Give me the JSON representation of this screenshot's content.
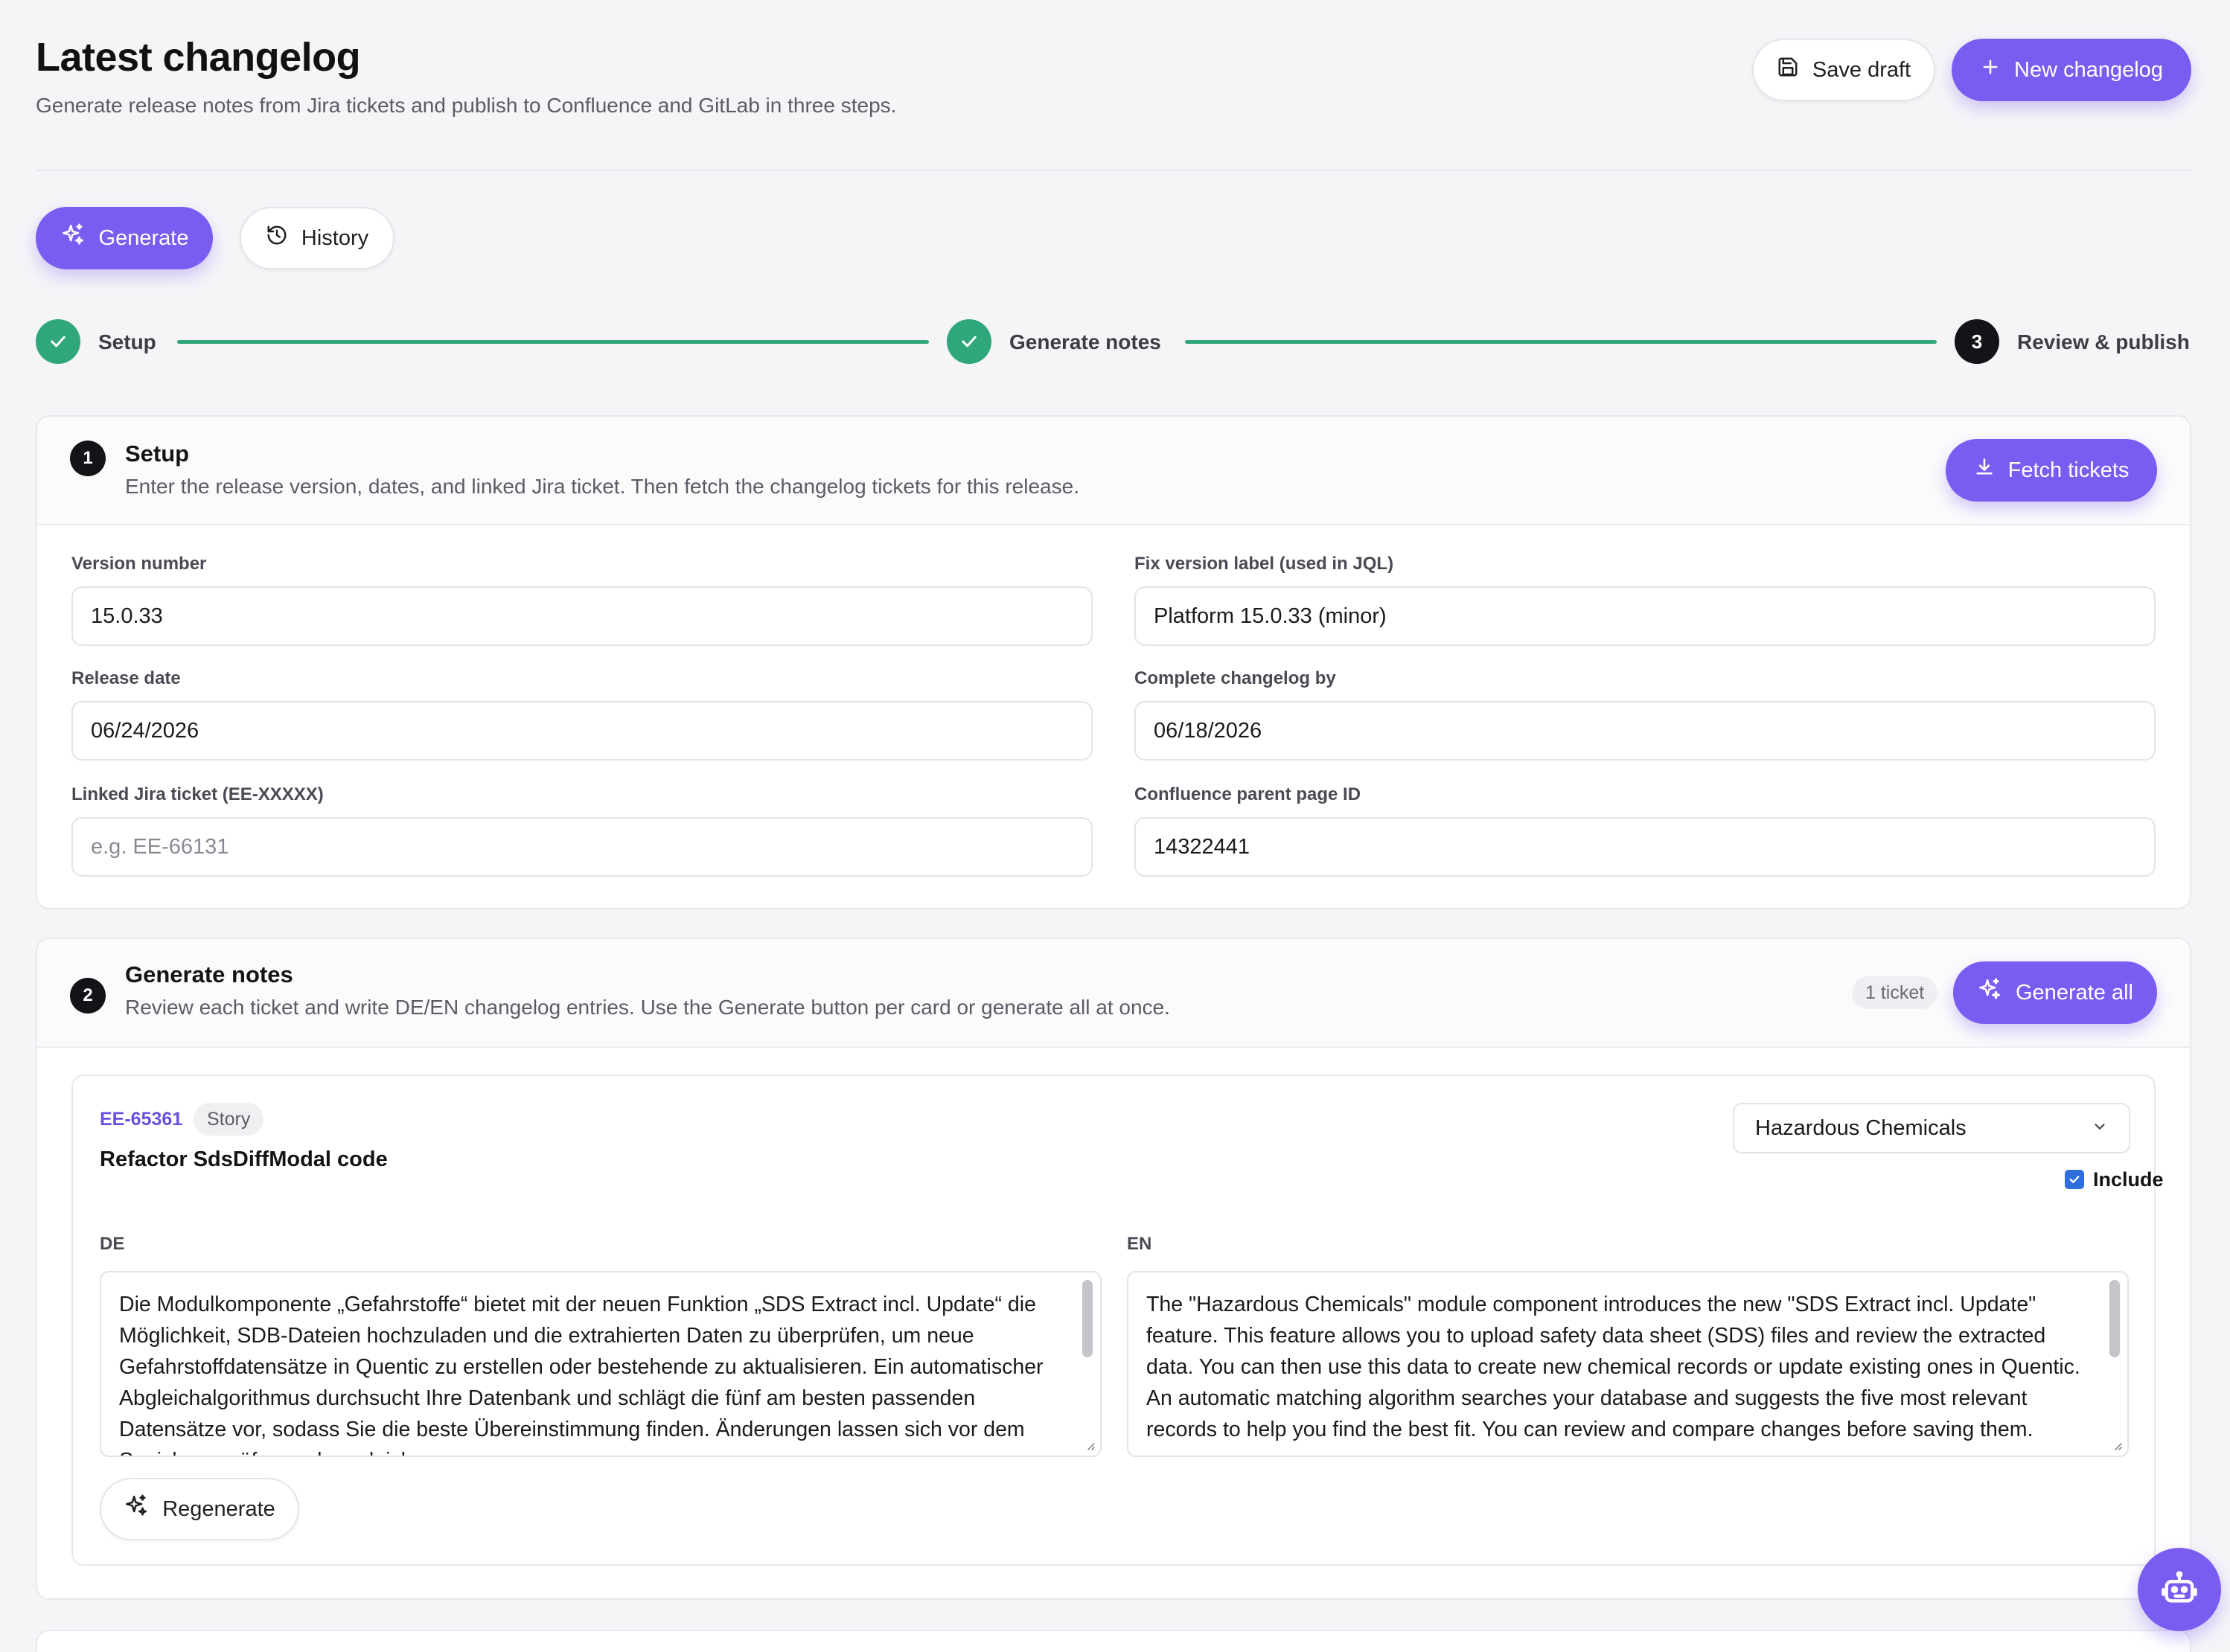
{
  "header": {
    "title": "Latest changelog",
    "subtitle": "Generate release notes from Jira tickets and publish to Confluence and GitLab in three steps.",
    "save_draft_label": "Save draft",
    "new_changelog_label": "New changelog"
  },
  "tabs": {
    "generate_label": "Generate",
    "history_label": "History"
  },
  "stepper": {
    "steps": [
      {
        "label": "Setup",
        "status": "done"
      },
      {
        "label": "Generate notes",
        "status": "done"
      },
      {
        "label": "Review & publish",
        "status": "current",
        "number": "3"
      }
    ]
  },
  "setup": {
    "number": "1",
    "title": "Setup",
    "description": "Enter the release version, dates, and linked Jira ticket. Then fetch the changelog tickets for this release.",
    "fetch_label": "Fetch tickets",
    "fields": {
      "version_label": "Version number",
      "version_value": "15.0.33",
      "fix_version_label": "Fix version label (used in JQL)",
      "fix_version_value": "Platform 15.0.33 (minor)",
      "release_date_label": "Release date",
      "release_date_value": "06/24/2026",
      "complete_by_label": "Complete changelog by",
      "complete_by_value": "06/18/2026",
      "jira_label": "Linked Jira ticket (EE-XXXXX)",
      "jira_placeholder": "e.g. EE-66131",
      "confluence_label": "Confluence parent page ID",
      "confluence_value": "14322441"
    }
  },
  "generate": {
    "number": "2",
    "title": "Generate notes",
    "description": "Review each ticket and write DE/EN changelog entries. Use the Generate button per card or generate all at once.",
    "count_label": "1 ticket",
    "generate_all_label": "Generate all",
    "ticket": {
      "key": "EE-65361",
      "type": "Story",
      "title": "Refactor SdsDiffModal code",
      "module": "Hazardous Chemicals",
      "include_label": "Include",
      "include_checked": true,
      "de_label": "DE",
      "en_label": "EN",
      "de_text": "Die Modulkomponente „Gefahrstoffe“ bietet mit der neuen Funktion „SDS Extract incl. Update“ die Möglichkeit, SDB-Dateien hochzuladen und die extrahierten Daten zu überprüfen, um neue Gefahrstoffdatensätze in Quentic zu erstellen oder bestehende zu aktualisieren. Ein automatischer Abgleichalgorithmus durchsucht Ihre Datenbank und schlägt die fünf am besten passenden Datensätze vor, sodass Sie die beste Übereinstimmung finden. Änderungen lassen sich vor dem Speichern prüfen und vergleichen.",
      "en_text": "The \"Hazardous Chemicals\" module component introduces the new \"SDS Extract incl. Update\" feature. This feature allows you to upload safety data sheet (SDS) files and review the extracted data. You can then use this data to create new chemical records or update existing ones in Quentic. An automatic matching algorithm searches your database and suggests the five most relevant records to help you find the best fit. You can review and compare changes before saving them.",
      "regenerate_label": "Regenerate"
    }
  },
  "colors": {
    "accent": "#7b5cf0",
    "success": "#2fa77a",
    "dark": "#141418"
  },
  "icons": {
    "save": "floppy-disk-icon",
    "new": "plus-icon",
    "generate": "sparkles-icon",
    "history": "history-icon",
    "fetch": "download-icon",
    "select": "chevron-down-icon",
    "assistant": "robot-icon"
  }
}
